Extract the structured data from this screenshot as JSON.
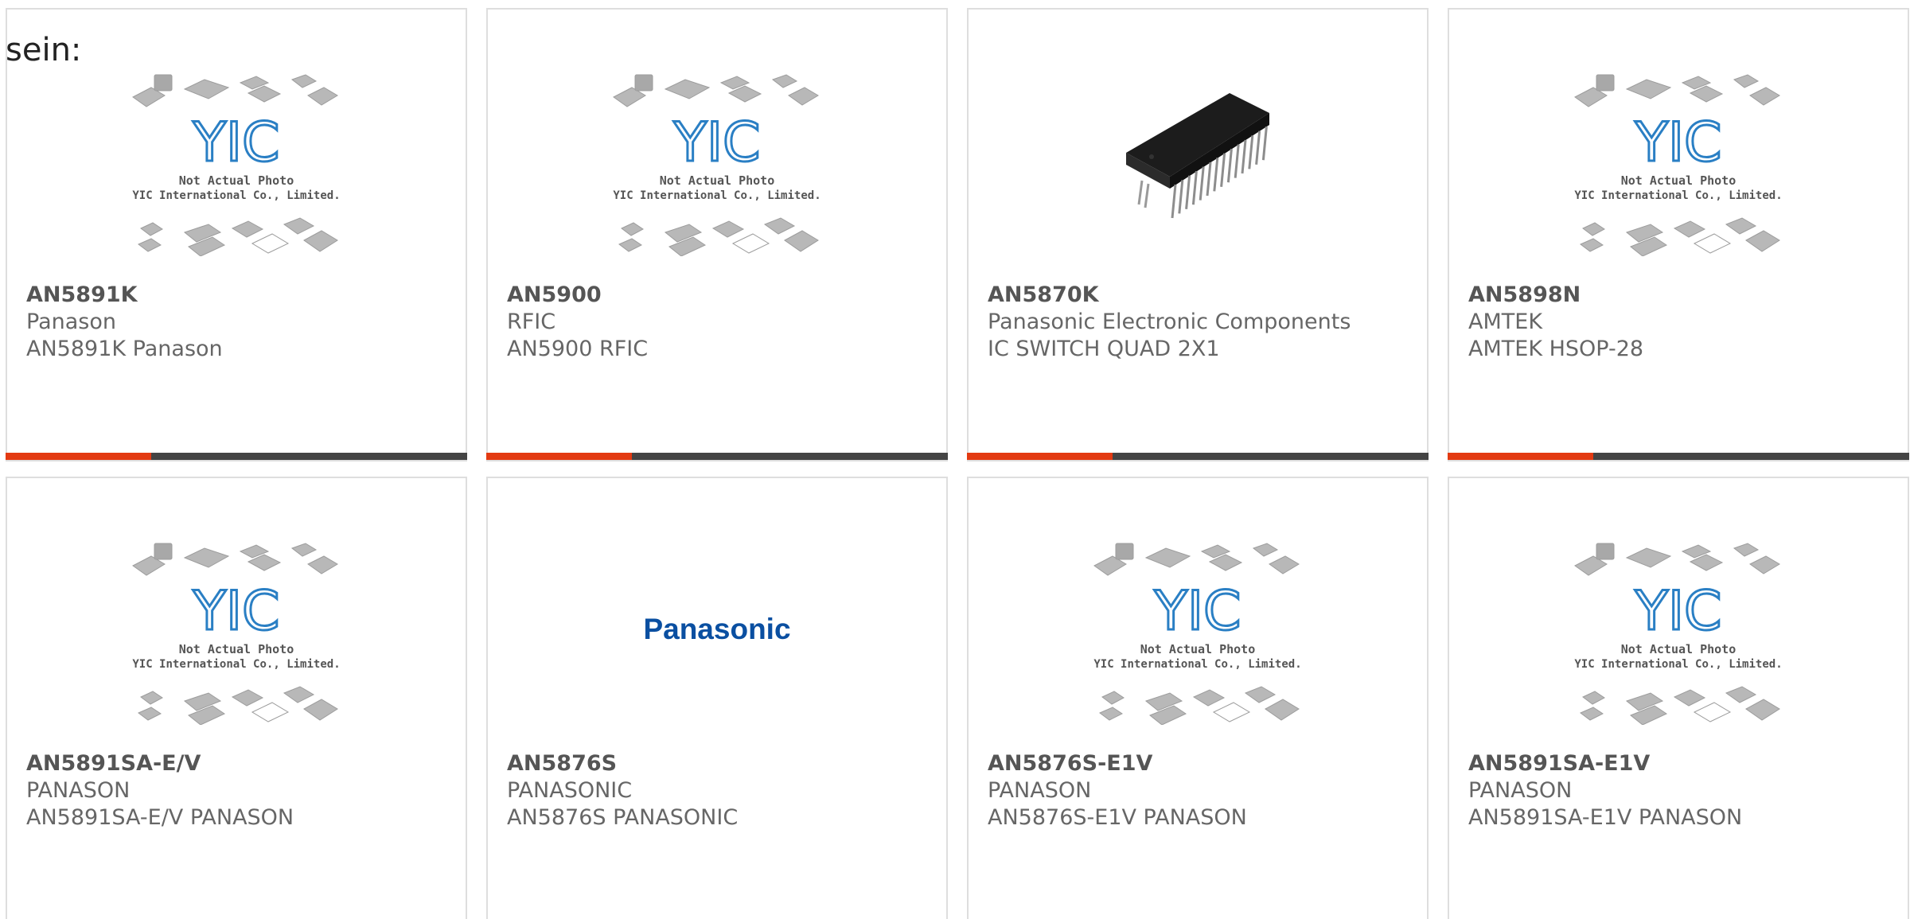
{
  "intro": "sein:",
  "placeholder_text": {
    "line1": "Not Actual Photo",
    "line2": "YIC International Co., Limited.",
    "logo": "YIC"
  },
  "brand_logo": "Panasonic",
  "colors": {
    "accent": "#e33a12",
    "bar": "#444444",
    "yic_blue": "#2a7fc4",
    "panasonic_blue": "#0a4fa1"
  },
  "products": [
    {
      "part": "AN5891K",
      "maker": "Panason",
      "desc": "AN5891K Panason",
      "image": "yic-placeholder"
    },
    {
      "part": "AN5900",
      "maker": "RFIC",
      "desc": "AN5900 RFIC",
      "image": "yic-placeholder"
    },
    {
      "part": "AN5870K",
      "maker": "Panasonic Electronic Components",
      "desc": "IC SWITCH QUAD 2X1",
      "image": "dip-chip-photo"
    },
    {
      "part": "AN5898N",
      "maker": "AMTEK",
      "desc": "AMTEK HSOP-28",
      "image": "yic-placeholder"
    },
    {
      "part": "AN5891SA-E/V",
      "maker": "PANASON",
      "desc": "AN5891SA-E/V PANASON",
      "image": "yic-placeholder"
    },
    {
      "part": "AN5876S",
      "maker": "PANASONIC",
      "desc": "AN5876S PANASONIC",
      "image": "panasonic-logo"
    },
    {
      "part": "AN5876S-E1V",
      "maker": "PANASON",
      "desc": "AN5876S-E1V PANASON",
      "image": "yic-placeholder"
    },
    {
      "part": "AN5891SA-E1V",
      "maker": "PANASON",
      "desc": "AN5891SA-E1V PANASON",
      "image": "yic-placeholder"
    }
  ]
}
